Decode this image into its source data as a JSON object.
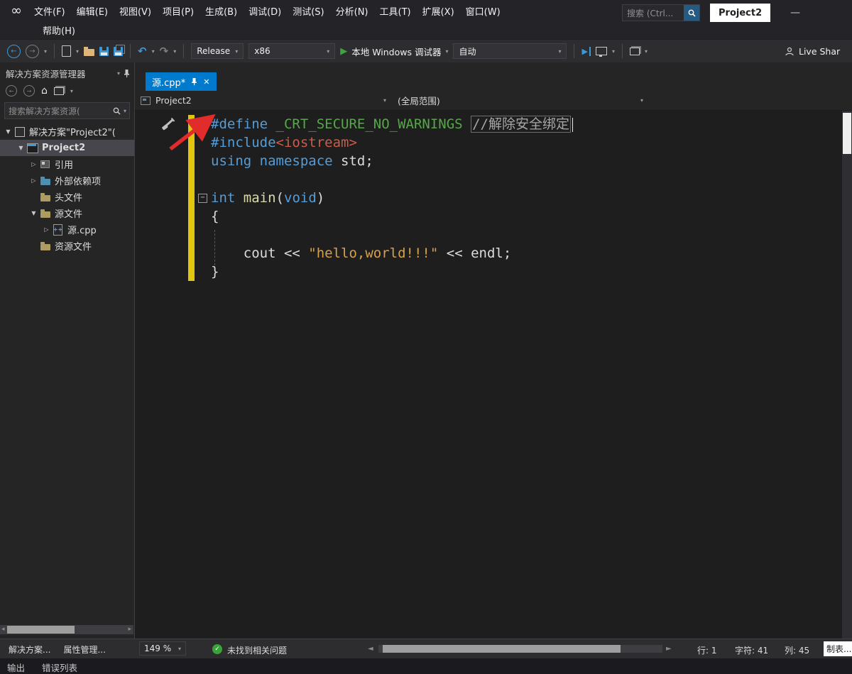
{
  "colors": {
    "accent": "#007ACC",
    "keyword": "#569CD6",
    "macro": "#57A64A",
    "comment": "#A6A6A6",
    "include": "#CE5A47",
    "string": "#D7A04A",
    "function": "#DCDCAA",
    "plain": "#DCDCDC",
    "change_bar": "#E2C50E",
    "run_green": "#3FA33F",
    "check_green": "#39A339",
    "annotation_red": "#E22B2B",
    "selection_gray": "#46464C"
  },
  "icons": {
    "infinity_logo": "∞",
    "back": "←",
    "forward": "→",
    "undo": "↶",
    "redo": "↷",
    "play": "▶",
    "caret": "▾",
    "home": "⌂",
    "close": "✕",
    "minimize": "—",
    "check": "✓",
    "scroll_left": "◄",
    "scroll_right": "►",
    "small_left": "◂",
    "small_right": "▸",
    "expanded": "▼",
    "collapsed": "▷",
    "fold_minus": "−",
    "cpp_plus": "++"
  },
  "titlebar": {
    "menus_row1": [
      "文件(F)",
      "编辑(E)",
      "视图(V)",
      "项目(P)",
      "生成(B)",
      "调试(D)",
      "测试(S)",
      "分析(N)",
      "工具(T)",
      "扩展(X)",
      "窗口(W)"
    ],
    "menus_row2": [
      "帮助(H)"
    ],
    "search_placeholder": "搜索 (Ctrl...",
    "project_button": "Project2"
  },
  "toolbar": {
    "config": "Release",
    "platform": "x86",
    "run_label": "本地 Windows 调试器",
    "attach": "自动",
    "live_share": "Live Shar"
  },
  "sidebar": {
    "title": "解决方案资源管理器",
    "search_placeholder": "搜索解决方案资源(",
    "tree": [
      {
        "label": "解决方案\"Project2\"(",
        "icon": "solution",
        "indent": 0,
        "arrow": "expanded"
      },
      {
        "label": "Project2",
        "icon": "cpp-project",
        "indent": 1,
        "arrow": "expanded",
        "selected": true,
        "bold": true
      },
      {
        "label": "引用",
        "icon": "references",
        "indent": 2,
        "arrow": "collapsed"
      },
      {
        "label": "外部依赖项",
        "icon": "ext-deps",
        "indent": 2,
        "arrow": "collapsed"
      },
      {
        "label": "头文件",
        "icon": "folder",
        "indent": 2,
        "arrow": ""
      },
      {
        "label": "源文件",
        "icon": "folder",
        "indent": 2,
        "arrow": "expanded"
      },
      {
        "label": "源.cpp",
        "icon": "cpp-file",
        "indent": 3,
        "arrow": "collapsed"
      },
      {
        "label": "资源文件",
        "icon": "folder",
        "indent": 2,
        "arrow": ""
      }
    ],
    "bottom_tabs": [
      "解决方案...",
      "属性管理..."
    ]
  },
  "editor": {
    "tab_label": "源.cpp*",
    "breadcrumb_project": "Project2",
    "breadcrumb_scope": "(全局范围)",
    "code_lines": [
      {
        "chg": true,
        "fold": "",
        "tokens": [
          {
            "t": "#define ",
            "c": "kw"
          },
          {
            "t": "_CRT_SECURE_NO_WARNINGS",
            "c": "macro"
          },
          {
            "t": " ",
            "c": "pl"
          },
          {
            "t": "//解除安全绑定",
            "c": "com",
            "box": true,
            "cursor": true
          }
        ]
      },
      {
        "chg": true,
        "fold": "",
        "tokens": [
          {
            "t": "#include",
            "c": "kw"
          },
          {
            "t": "<iostream>",
            "c": "inc"
          }
        ]
      },
      {
        "chg": true,
        "fold": "",
        "tokens": [
          {
            "t": "using",
            "c": "kw"
          },
          {
            "t": " ",
            "c": "pl"
          },
          {
            "t": "namespace",
            "c": "kw"
          },
          {
            "t": " std;",
            "c": "pl"
          }
        ]
      },
      {
        "chg": true,
        "fold": "",
        "tokens": []
      },
      {
        "chg": true,
        "fold": "minus",
        "tokens": [
          {
            "t": "int",
            "c": "kw"
          },
          {
            "t": " ",
            "c": "pl"
          },
          {
            "t": "main",
            "c": "fn"
          },
          {
            "t": "(",
            "c": "pl"
          },
          {
            "t": "void",
            "c": "kw"
          },
          {
            "t": ")",
            "c": "pl"
          }
        ]
      },
      {
        "chg": true,
        "fold": "guide",
        "tokens": [
          {
            "t": "{",
            "c": "pl"
          }
        ]
      },
      {
        "chg": true,
        "fold": "guide",
        "tokens": []
      },
      {
        "chg": true,
        "fold": "guide",
        "tokens": [
          {
            "t": "    cout << ",
            "c": "pl"
          },
          {
            "t": "\"hello,world!!!\"",
            "c": "str"
          },
          {
            "t": " << endl;",
            "c": "pl"
          }
        ]
      },
      {
        "chg": true,
        "fold": "guide-end",
        "tokens": [
          {
            "t": "}",
            "c": "pl"
          }
        ]
      }
    ]
  },
  "statusbar": {
    "zoom": "149 %",
    "message": "未找到相关问题",
    "line": "行: 1",
    "characters": "字符: 41",
    "column": "列: 45",
    "tab_indicator": "制表..."
  },
  "bottom": {
    "output_tabs": [
      "输出",
      "错误列表"
    ]
  }
}
